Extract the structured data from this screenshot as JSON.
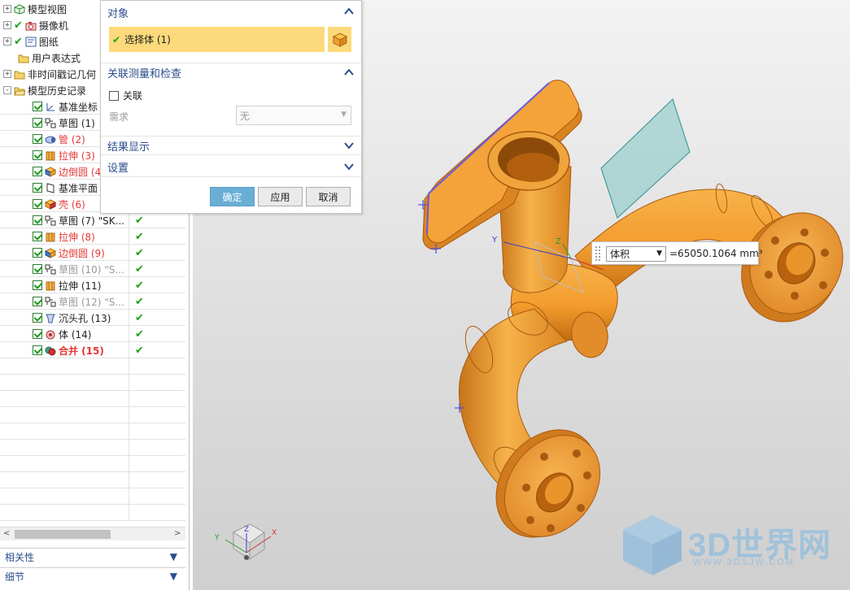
{
  "navigator": {
    "tree_top": [
      {
        "toggle": "+",
        "icon": "model-views-icon",
        "label": "模型视图"
      },
      {
        "toggle": "+",
        "icon": "camera-icon",
        "label": "摄像机"
      },
      {
        "toggle": "+",
        "icon": "drawing-sheet-icon",
        "label": "图纸"
      },
      {
        "toggle": "",
        "icon": "folder-icon",
        "label": "用户表达式"
      },
      {
        "toggle": "+",
        "icon": "folder-icon",
        "label": "非时间戳记几何"
      },
      {
        "toggle": "-",
        "icon": "folder-open-icon",
        "label": "模型历史记录"
      }
    ],
    "features": [
      {
        "icon": "datum-csys-icon",
        "label": "基准坐标",
        "style": "",
        "status": ""
      },
      {
        "icon": "sketch-icon",
        "label": "草图 (1)",
        "style": "",
        "status": ""
      },
      {
        "icon": "tube-icon",
        "label": "管 (2)",
        "style": "red",
        "status": ""
      },
      {
        "icon": "extrude-icon",
        "label": "拉伸 (3)",
        "style": "red",
        "status": ""
      },
      {
        "icon": "edge-blend-icon",
        "label": "边倒圆 (4)",
        "style": "red",
        "status": ""
      },
      {
        "icon": "datum-plane-icon",
        "label": "基准平面",
        "style": "",
        "status": ""
      },
      {
        "icon": "shell-icon",
        "label": "壳 (6)",
        "style": "red",
        "status": ""
      },
      {
        "icon": "sketch-icon",
        "label": "草图 (7) \"SK...",
        "style": "",
        "status": "✔"
      },
      {
        "icon": "extrude-icon",
        "label": "拉伸 (8)",
        "style": "red",
        "status": "✔"
      },
      {
        "icon": "edge-blend-icon",
        "label": "边倒圆 (9)",
        "style": "red",
        "status": "✔"
      },
      {
        "icon": "sketch-icon",
        "label": "草图 (10) \"S...",
        "style": "gray",
        "status": "✔"
      },
      {
        "icon": "extrude-icon",
        "label": "拉伸 (11)",
        "style": "",
        "status": "✔"
      },
      {
        "icon": "sketch-icon",
        "label": "草图 (12) \"S...",
        "style": "gray",
        "status": "✔"
      },
      {
        "icon": "counterbore-hole-icon",
        "label": "沉头孔 (13)",
        "style": "",
        "status": "✔"
      },
      {
        "icon": "body-icon",
        "label": "体 (14)",
        "style": "",
        "status": "✔"
      },
      {
        "icon": "unite-icon",
        "label": "合并 (15)",
        "style": "red-bold",
        "status": "✔"
      }
    ],
    "panels": [
      {
        "label": "相关性"
      },
      {
        "label": "细节"
      }
    ]
  },
  "dialog": {
    "sections": {
      "object": "对象",
      "associative": "关联测量和检查",
      "results": "结果显示",
      "settings": "设置"
    },
    "select_body": "选择体 (1)",
    "associative_checkbox": "关联",
    "requirement_label": "需求",
    "requirement_value": "无",
    "buttons": {
      "ok": "确定",
      "apply": "应用",
      "cancel": "取消"
    }
  },
  "measure": {
    "type": "体积",
    "value": "=65050.1064 mm³"
  },
  "triad_labels": {
    "x": "X",
    "y": "Y",
    "z": "Z"
  },
  "watermark": {
    "title": "3D世界网",
    "url": "WWW.3DSJW.COM"
  },
  "colors": {
    "part": "#f4a33a",
    "part_dark": "#c06d14",
    "part_edge": "#a85a10",
    "selection_bg": "#fcd97a",
    "header_text": "#2b4e8c",
    "datum_plane": "#7fc4c4",
    "ok_button": "#6aaed6",
    "check_green": "#1aa31a"
  }
}
